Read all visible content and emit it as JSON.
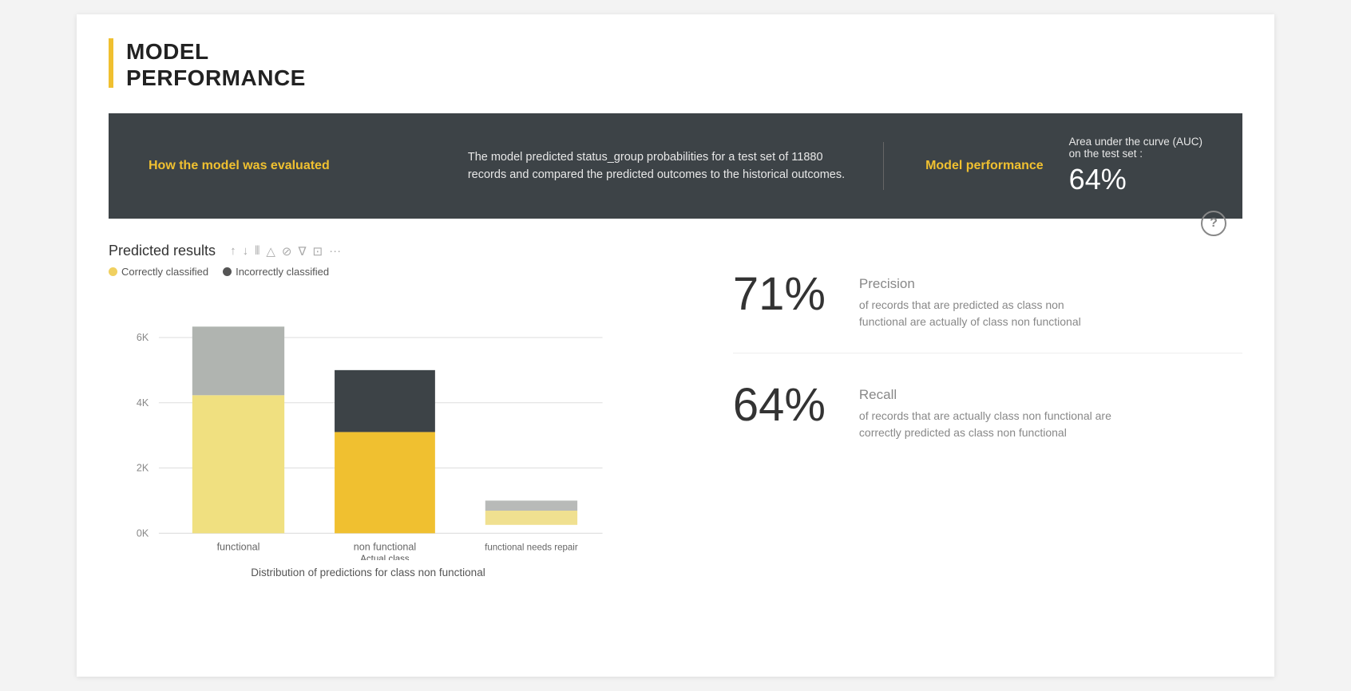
{
  "page": {
    "title_line1": "MODEL",
    "title_line2": "PERFORMANCE"
  },
  "banner": {
    "how_label": "How the model was evaluated",
    "description": "The model predicted status_group probabilities for a test set of 11880 records and compared the predicted outcomes to the historical outcomes.",
    "performance_label": "Model performance",
    "auc_desc": "Area under the curve (AUC)\non the test set :",
    "auc_value": "64%"
  },
  "chart": {
    "title": "Predicted results",
    "toolbar_icons": [
      "↑",
      "↓",
      "||",
      "△",
      "⊘",
      "∇",
      "⊡",
      "···"
    ],
    "legend": [
      {
        "label": "Correctly classified",
        "color": "#f0d060"
      },
      {
        "label": "Incorrectly classified",
        "color": "#555555"
      }
    ],
    "bars": [
      {
        "label": "functional",
        "correct": 4200,
        "incorrect": 2100,
        "correct_color": "#f0d878",
        "incorrect_color": "#b0b4b0"
      },
      {
        "label": "non functional",
        "sublabel": "Actual class",
        "correct": 3100,
        "incorrect": 1900,
        "correct_color": "#f0c030",
        "incorrect_color": "#3d4347"
      },
      {
        "label": "functional needs repair",
        "correct": 430,
        "incorrect": 310,
        "correct_color": "#f0e090",
        "incorrect_color": "#b8bab8"
      }
    ],
    "y_labels": [
      "0K",
      "2K",
      "4K",
      "6K"
    ],
    "y_max": 6600,
    "footer": "Distribution of predictions for class non functional"
  },
  "metrics": [
    {
      "value": "71%",
      "label": "Precision",
      "desc": "of records that are predicted as class non functional are actually of class non functional"
    },
    {
      "value": "64%",
      "label": "Recall",
      "desc": "of records that are actually class non functional are correctly predicted as class non functional"
    }
  ],
  "help_icon": "?"
}
